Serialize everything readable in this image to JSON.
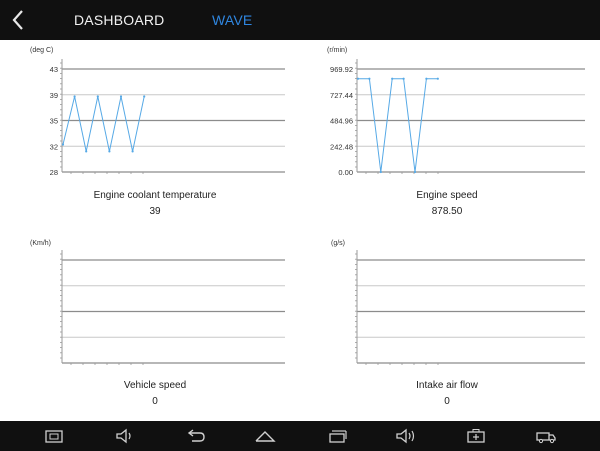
{
  "header": {
    "back_icon": "chevron-left-icon",
    "tabs": [
      {
        "label": "DASHBOARD",
        "active": false
      },
      {
        "label": "WAVE",
        "active": true
      }
    ],
    "active_color": "#2f86e0"
  },
  "charts": {
    "coolant": {
      "unit": "(deg C)",
      "ticks": [
        "43",
        "39",
        "35",
        "32",
        "28"
      ],
      "label": "Engine coolant temperature",
      "value": "39"
    },
    "speed": {
      "unit": "(r/min)",
      "ticks": [
        "969.92",
        "727.44",
        "484.96",
        "242.48",
        "0.00"
      ],
      "label": "Engine speed",
      "value": "878.50"
    },
    "vehicle": {
      "unit": "(Km/h)",
      "ticks": [],
      "label": "Vehicle speed",
      "value": "0"
    },
    "airflow": {
      "unit": "(g/s)",
      "ticks": [],
      "label": "Intake air flow",
      "value": "0"
    }
  },
  "chart_data": [
    {
      "type": "line",
      "ylabel": "(deg C)",
      "ylim": [
        28,
        43
      ],
      "yticks": [
        28,
        32,
        35,
        39,
        43
      ],
      "series": [
        {
          "values": [
            32,
            39,
            31,
            39,
            31,
            39,
            31,
            39
          ]
        }
      ],
      "label": "Engine coolant temperature",
      "current": 39,
      "color": "#56a9e6"
    },
    {
      "type": "line",
      "ylabel": "(r/min)",
      "ylim": [
        0,
        969.92
      ],
      "yticks": [
        0,
        242.48,
        484.96,
        727.44,
        969.92
      ],
      "series": [
        {
          "values": [
            878.5,
            878.5,
            0,
            878.5,
            878.5,
            0,
            878.5,
            878.5
          ]
        }
      ],
      "label": "Engine speed",
      "current": 878.5,
      "color": "#56a9e6"
    },
    {
      "type": "line",
      "ylabel": "(Km/h)",
      "series": [
        {
          "values": []
        }
      ],
      "label": "Vehicle speed",
      "current": 0
    },
    {
      "type": "line",
      "ylabel": "(g/s)",
      "series": [
        {
          "values": []
        }
      ],
      "label": "Intake air flow",
      "current": 0
    }
  ],
  "navbar": {
    "icons": [
      "screenshot-icon",
      "volume-down-icon",
      "back-arrow-icon",
      "home-icon",
      "recent-apps-icon",
      "volume-up-icon",
      "toolbox-icon",
      "vehicle-icon"
    ]
  }
}
